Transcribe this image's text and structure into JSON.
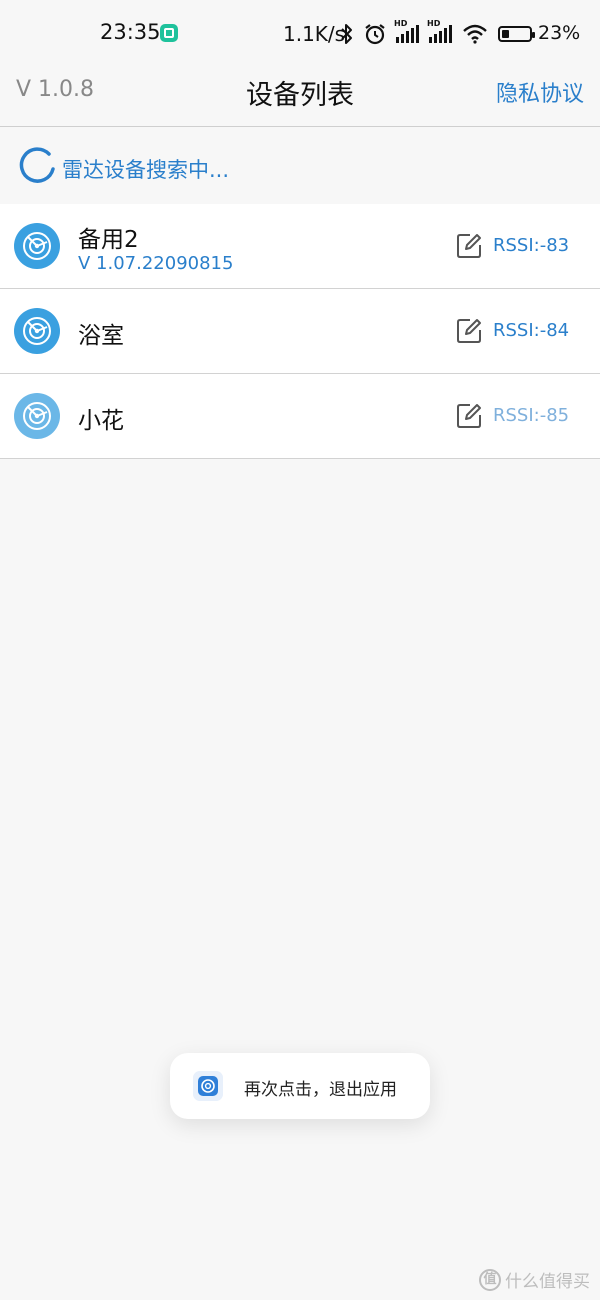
{
  "status_bar": {
    "time": "23:35",
    "net_speed": "1.1K/s",
    "battery": "23%",
    "icons": [
      "mi-app-icon",
      "bluetooth-icon",
      "alarm-icon",
      "hd-signal-icon",
      "hd-signal-icon",
      "wifi-icon",
      "battery-icon"
    ]
  },
  "header": {
    "version": "V 1.0.8",
    "title": "设备列表",
    "privacy_link": "隐私协议"
  },
  "search": {
    "status_text": "雷达设备搜索中..."
  },
  "devices": [
    {
      "name": "备用2",
      "version": "V 1.07.22090815",
      "rssi": "RSSI:-83"
    },
    {
      "name": "浴室",
      "rssi": "RSSI:-84"
    },
    {
      "name": "小花",
      "rssi": "RSSI:-85"
    }
  ],
  "toast": {
    "text": "再次点击，退出应用"
  },
  "watermark": {
    "text": "什么值得买",
    "logo_text": "值"
  },
  "colors": {
    "accent": "#2a7fcb",
    "radar_icon_bg": "#3aa0e0",
    "background": "#f7f7f7"
  }
}
